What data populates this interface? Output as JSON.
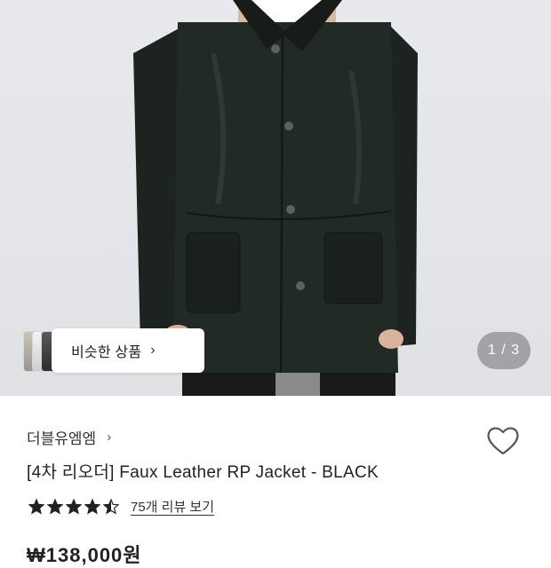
{
  "hero": {
    "counter": "1 / 3",
    "similar_label": "비슷한 상품",
    "similar_chevron": "›"
  },
  "product": {
    "brand": "더블유엠엠",
    "brand_chevron": "›",
    "title": "[4차 리오더] Faux Leather RP Jacket - BLACK",
    "rating": 4.5,
    "review_link": "75개 리뷰 보기",
    "price_partial": "₩138,000원"
  },
  "icons": {
    "wishlist": "heart-outline-icon",
    "rating": "star-icon"
  },
  "colors": {
    "jacket": "#1f2421",
    "background": "#e5e7ea",
    "star": "#222222"
  }
}
